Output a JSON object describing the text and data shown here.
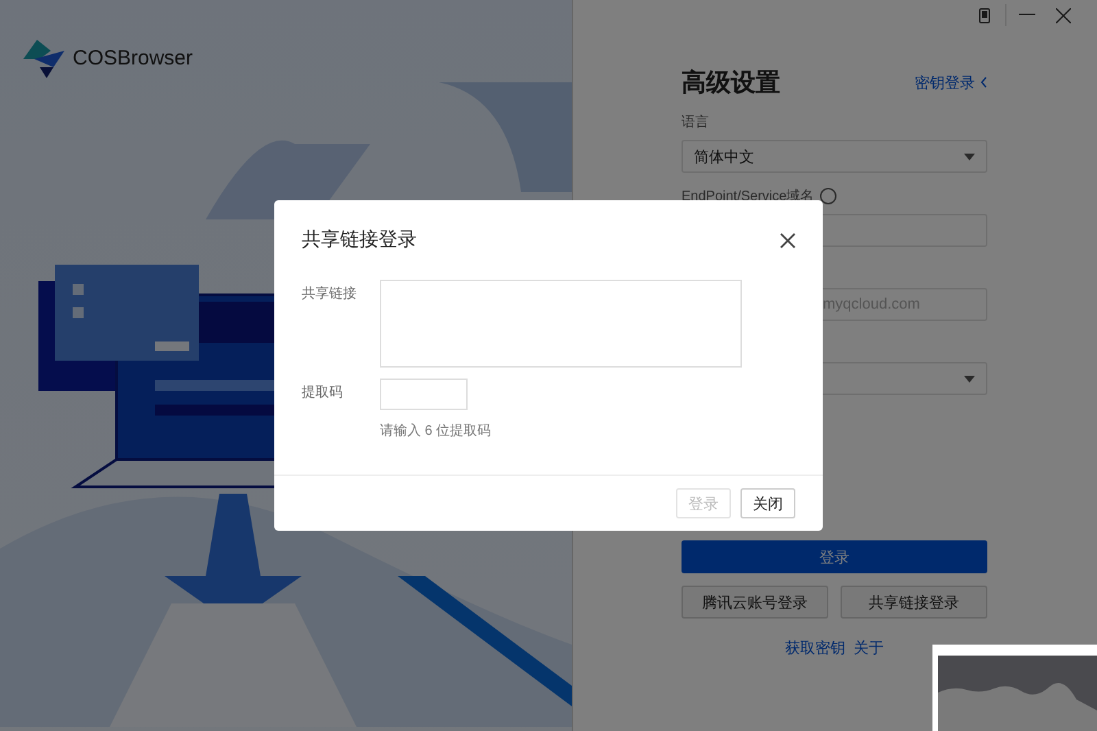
{
  "app": {
    "name": "COSBrowser"
  },
  "window_controls": [
    {
      "kind": "phone"
    },
    {
      "kind": "minimize"
    },
    {
      "kind": "close"
    }
  ],
  "settings": {
    "title": "高级设置",
    "switch_link": "密钥登录",
    "fields": [
      {
        "kind": "select",
        "label": "语言",
        "value": "简体中文"
      },
      {
        "kind": "input",
        "label": "EndPoint/Service域名",
        "help": true
      },
      {
        "kind": "input",
        "placeholder": "myqcloud.com"
      },
      {
        "kind": "select"
      }
    ],
    "login_button": "登录",
    "alt_buttons": [
      "腾讯云账号登录",
      "共享链接登录"
    ],
    "links": [
      "获取密钥",
      "关于"
    ]
  },
  "dialog": {
    "title": "共享链接登录",
    "fields": [
      {
        "kind": "textarea",
        "label": "共享链接"
      },
      {
        "kind": "input",
        "label": "提取码",
        "hint": "请输入 6 位提取码"
      }
    ],
    "buttons": [
      {
        "label": "登录",
        "disabled": true
      },
      {
        "label": "关闭",
        "disabled": false
      }
    ]
  }
}
